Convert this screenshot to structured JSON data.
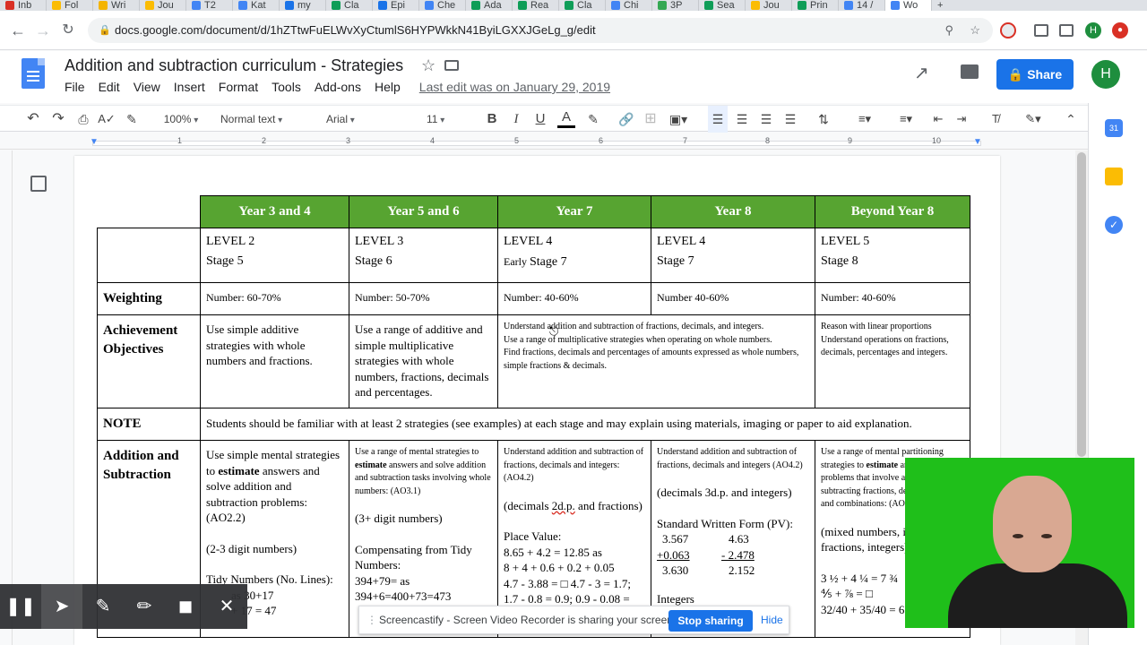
{
  "browser": {
    "tabs": [
      "Inb",
      "Fol",
      "Wri",
      "Jou",
      "T2",
      "Kat",
      "my",
      "Cla",
      "Epi",
      "Che",
      "Ada",
      "Rea",
      "Cla",
      "Chi",
      "3P",
      "Sea",
      "Jou",
      "Prin",
      "14 /",
      "Wo"
    ],
    "new_tab": "+",
    "url": "docs.google.com/document/d/1hZTtwFuELWvXyCtumlS6HYPWkkN41ByiLGXXJGeLg_g/edit",
    "profile_initial": "H"
  },
  "doc": {
    "title": "Addition and subtraction curriculum - Strategies",
    "menu": [
      "File",
      "Edit",
      "View",
      "Insert",
      "Format",
      "Tools",
      "Add-ons",
      "Help"
    ],
    "last_edit": "Last edit was on January 29, 2019",
    "share_label": "Share",
    "avatar_initial": "H"
  },
  "toolbar": {
    "zoom": "100%",
    "style": "Normal text",
    "font": "Arial",
    "size": "11",
    "bold": "B",
    "italic": "I",
    "underline": "U",
    "text_color": "A"
  },
  "ruler_numbers": [
    "1",
    "2",
    "3",
    "4",
    "5",
    "6",
    "7",
    "8",
    "9",
    "10"
  ],
  "table": {
    "headers": [
      "Year 3 and 4",
      "Year 5 and 6",
      "Year 7",
      "Year 8",
      "Beyond Year 8"
    ],
    "levels": [
      {
        "level": "LEVEL 2",
        "prefix": "",
        "stage": "Stage 5"
      },
      {
        "level": "LEVEL 3",
        "prefix": "",
        "stage": "Stage 6"
      },
      {
        "level": "LEVEL 4",
        "prefix": "Early ",
        "stage": "Stage 7"
      },
      {
        "level": "LEVEL 4",
        "prefix": "",
        "stage": "Stage 7"
      },
      {
        "level": "LEVEL 5",
        "prefix": "",
        "stage": "Stage 8"
      }
    ],
    "weighting_label": "Weighting",
    "weighting": [
      "Number: 60-70%",
      "Number: 50-70%",
      "Number: 40-60%",
      "Number 40-60%",
      "Number: 40-60%"
    ],
    "ach_label_1": "Achievement",
    "ach_label_2": "Objectives",
    "ach_y34": "Use simple additive strategies with whole numbers and fractions.",
    "ach_y56": "Use a range of additive and simple multiplicative strategies with whole numbers, fractions, decimals and percentages.",
    "ach_y78_lines": [
      "Understand addition and subtraction of fractions, decimals, and integers.",
      "Use a range of multiplicative strategies when operating on whole numbers.",
      "Find fractions, decimals and percentages of amounts expressed as whole numbers, simple fractions & decimals."
    ],
    "ach_beyond_lines": [
      "Reason with linear proportions",
      "Understand operations on fractions, decimals, percentages and integers."
    ],
    "note_label": "NOTE",
    "note_text": "Students should be familiar with at least 2 strategies (see examples) at each stage and may explain using materials, imaging or paper to aid explanation.",
    "addsub_label_1": "Addition and",
    "addsub_label_2": "Subtraction",
    "y34": {
      "p1a": "Use simple mental strategies to ",
      "p1b": "estimate",
      "p1c": " answers and solve addition and subtraction problems: (AO2.2)",
      "p2": "(2-3 digit numbers)",
      "p3": "Tidy Numbers (No. Lines):",
      "p4": "as 30+17",
      "p5": "+ 17 = 47"
    },
    "y56": {
      "p1a": "Use a range of mental strategies to ",
      "p1b": "estimate",
      "p1c": " answers and solve addition and subtraction tasks involving whole numbers: (AO3.1)",
      "p2": "(3+ digit numbers)",
      "p3": "Compensating from Tidy Numbers:",
      "p4": "394+79= as",
      "p5": "394+6=400+73=473"
    },
    "y7": {
      "p1": "Understand addition and subtraction of fractions, decimals and integers: (AO4.2)",
      "p2a": "(decimals ",
      "p2b": "2d.p.",
      "p2c": " and fractions)",
      "p3": "Place Value:",
      "p4": "8.65 + 4.2 = 12.85 as",
      "p5": "8 + 4 + 0.6 + 0.2 + 0.05",
      "p6": "4.7 - 3.88 = □  4.7 - 3 = 1.7;",
      "p7": "1.7 - 0.8 = 0.9; 0.9 - 0.08 ="
    },
    "y8": {
      "p1": "Understand addition and subtraction of fractions, decimals and integers (AO4.2)",
      "p2": "(decimals 3d.p. and integers)",
      "p3": "Standard Written Form (PV):",
      "r1a": "3.567",
      "r1b": "4.63",
      "r2a": "+0.063",
      "r2b": "- 2.478",
      "r3a": "3.630",
      "r3b": "2.152",
      "p4": "Integers"
    },
    "beyond": {
      "p1a": "Use a range of mental partitioning strategies to ",
      "p1b": "estimate",
      "p1c": " and solve problems that involve adding and subtracting fractions, decimals, integers and combinations: (AO5.3, 5.4)",
      "p2": "(mixed numbers, improper fractions, integers)",
      "p3": "3 ½ + 4 ¼ = 7 ¾",
      "p4": "⅘ + ⅞ = □",
      "p5": "32/40 + 35/40 = 67/40"
    }
  },
  "cast": {
    "message": "Screencastify - Screen Video Recorder is sharing your screen.",
    "stop": "Stop sharing",
    "hide": "Hide"
  },
  "colors": {
    "header_green": "#57a431",
    "share_blue": "#1a73e8",
    "webcam_green": "#1fbf1a"
  }
}
